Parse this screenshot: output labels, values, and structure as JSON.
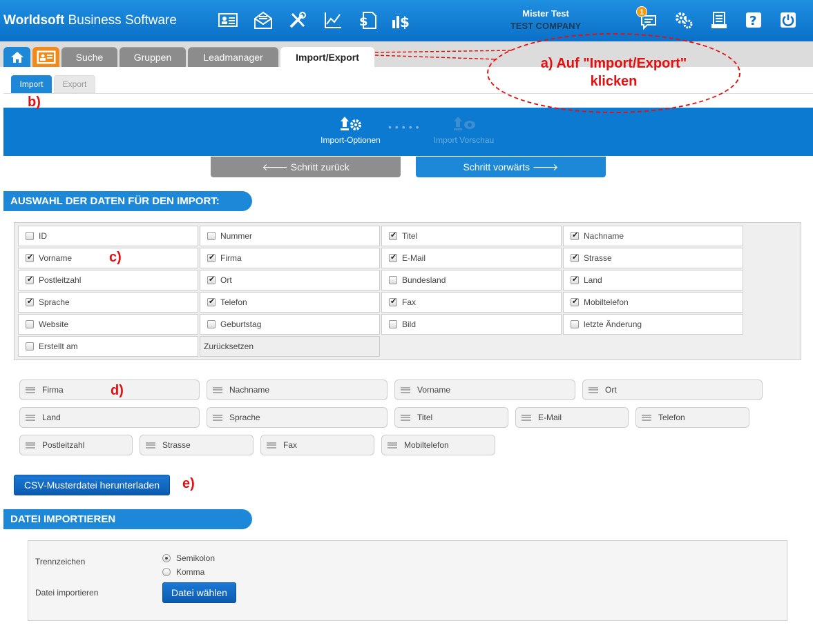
{
  "app": {
    "brand_bold": "Worldsoft",
    "brand_rest": " Business Software"
  },
  "header": {
    "icons": [
      "contact-card-icon",
      "mail-icon",
      "tools-icon",
      "chart-icon",
      "invoice-icon",
      "finance-icon"
    ],
    "user_name": "Mister Test",
    "company": "TEST COMPANY",
    "notification_count": "1",
    "right_icons": [
      "messages-icon",
      "settings-icon",
      "newsletter-icon",
      "help-icon",
      "power-icon"
    ]
  },
  "tabs": [
    {
      "label": "Suche"
    },
    {
      "label": "Gruppen"
    },
    {
      "label": "Leadmanager"
    },
    {
      "label": "Import/Export"
    }
  ],
  "subtabs": {
    "import": "Import",
    "export": "Export"
  },
  "steps": {
    "step1": "Import-Optionen",
    "step2": "Import Vorschau"
  },
  "nav": {
    "back": "🡐 Schritt zurück",
    "forward": "Schritt vorwärts 🡒"
  },
  "section1": {
    "title": "AUSWAHL DER DATEN FÜR DEN IMPORT:"
  },
  "fields": [
    {
      "label": "ID",
      "checked": false
    },
    {
      "label": "Nummer",
      "checked": false
    },
    {
      "label": "Titel",
      "checked": true
    },
    {
      "label": "Nachname",
      "checked": true
    },
    {
      "label": "Vorname",
      "checked": true
    },
    {
      "label": "Firma",
      "checked": true
    },
    {
      "label": "E-Mail",
      "checked": true
    },
    {
      "label": "Strasse",
      "checked": true
    },
    {
      "label": "Postleitzahl",
      "checked": true
    },
    {
      "label": "Ort",
      "checked": true
    },
    {
      "label": "Bundesland",
      "checked": false
    },
    {
      "label": "Land",
      "checked": true
    },
    {
      "label": "Sprache",
      "checked": true
    },
    {
      "label": "Telefon",
      "checked": true
    },
    {
      "label": "Fax",
      "checked": true
    },
    {
      "label": "Mobiltelefon",
      "checked": true
    },
    {
      "label": "Website",
      "checked": false
    },
    {
      "label": "Geburtstag",
      "checked": false
    },
    {
      "label": "Bild",
      "checked": false
    },
    {
      "label": "letzte Änderung",
      "checked": false
    },
    {
      "label": "Erstellt am",
      "checked": false
    }
  ],
  "reset_label": "Zurücksetzen",
  "order": [
    "Firma",
    "Nachname",
    "Vorname",
    "Ort",
    "Land",
    "Sprache",
    "Titel",
    "E-Mail",
    "Telefon",
    "Postleitzahl",
    "Strasse",
    "Fax",
    "Mobiltelefon"
  ],
  "csv_button": "CSV-Musterdatei herunterladen",
  "section2": {
    "title": "DATEI IMPORTIEREN",
    "separator_label": "Trennzeichen",
    "opt_semicolon": "Semikolon",
    "opt_comma": "Komma",
    "separator_selected": "Semikolon",
    "file_label": "Datei importieren",
    "file_button": "Datei wählen"
  },
  "annotations": {
    "a": "a) Auf \"Import/Export\"",
    "a2": "klicken",
    "b": "b)",
    "c": "c)",
    "d": "d)",
    "e": "e)"
  },
  "colors": {
    "accent": "#1e88d8",
    "annotation": "#e31010",
    "tab_grey": "#8c8c8c",
    "home_orange": "#f08a1a"
  }
}
